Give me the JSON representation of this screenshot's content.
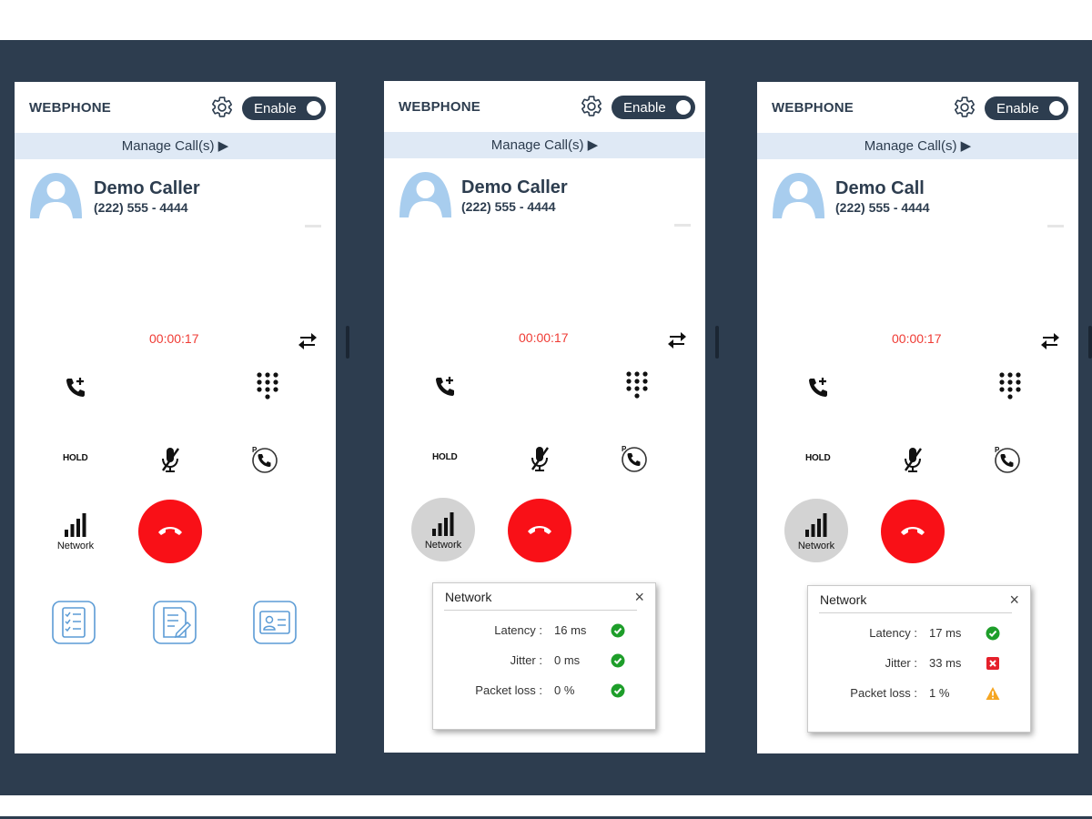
{
  "panels": [
    {
      "brand": "WEBPHONE",
      "toggle_label": "Enable",
      "manage_label": "Manage Call(s) ▶",
      "caller_name": "Demo Caller",
      "caller_number": "(222) 555 - 4444",
      "timer": "00:00:17",
      "hold_label": "HOLD",
      "network_label": "Network"
    },
    {
      "brand": "WEBPHONE",
      "toggle_label": "Enable",
      "manage_label": "Manage Call(s) ▶",
      "caller_name": "Demo Caller",
      "caller_number": "(222) 555 - 4444",
      "timer": "00:00:17",
      "hold_label": "HOLD",
      "network_label": "Network",
      "popup": {
        "title": "Network",
        "close": "×",
        "metrics": [
          {
            "label": "Latency :",
            "value": "16 ms",
            "status": "ok"
          },
          {
            "label": "Jitter :",
            "value": "0 ms",
            "status": "ok"
          },
          {
            "label": "Packet loss :",
            "value": "0 %",
            "status": "ok"
          }
        ]
      }
    },
    {
      "brand": "WEBPHONE",
      "toggle_label": "Enable",
      "manage_label": "Manage Call(s) ▶",
      "caller_name": "Demo Call",
      "caller_number": "(222) 555 - 4444",
      "timer": "00:00:17",
      "hold_label": "HOLD",
      "network_label": "Network",
      "popup": {
        "title": "Network",
        "close": "×",
        "metrics": [
          {
            "label": "Latency :",
            "value": "17 ms",
            "status": "ok"
          },
          {
            "label": "Jitter :",
            "value": "33 ms",
            "status": "error"
          },
          {
            "label": "Packet loss :",
            "value": "1 %",
            "status": "warning"
          }
        ]
      }
    }
  ],
  "colors": {
    "background_band": "#2d3d4f",
    "accent": "#2d3d4f",
    "manage_bar": "#dfe9f5",
    "timer": "#ef3b34",
    "hangup": "#f91017",
    "status_ok": "#1e9e2a",
    "status_error": "#e5202b",
    "status_warning": "#f5a623"
  },
  "icons": [
    "gear-icon",
    "avatar-icon",
    "swap-icon",
    "add-call-icon",
    "keypad-icon",
    "mute-icon",
    "park-icon",
    "signal-icon",
    "hangup-icon",
    "checklist-icon",
    "notes-icon",
    "contact-card-icon",
    "check-icon",
    "error-icon",
    "warning-icon"
  ]
}
